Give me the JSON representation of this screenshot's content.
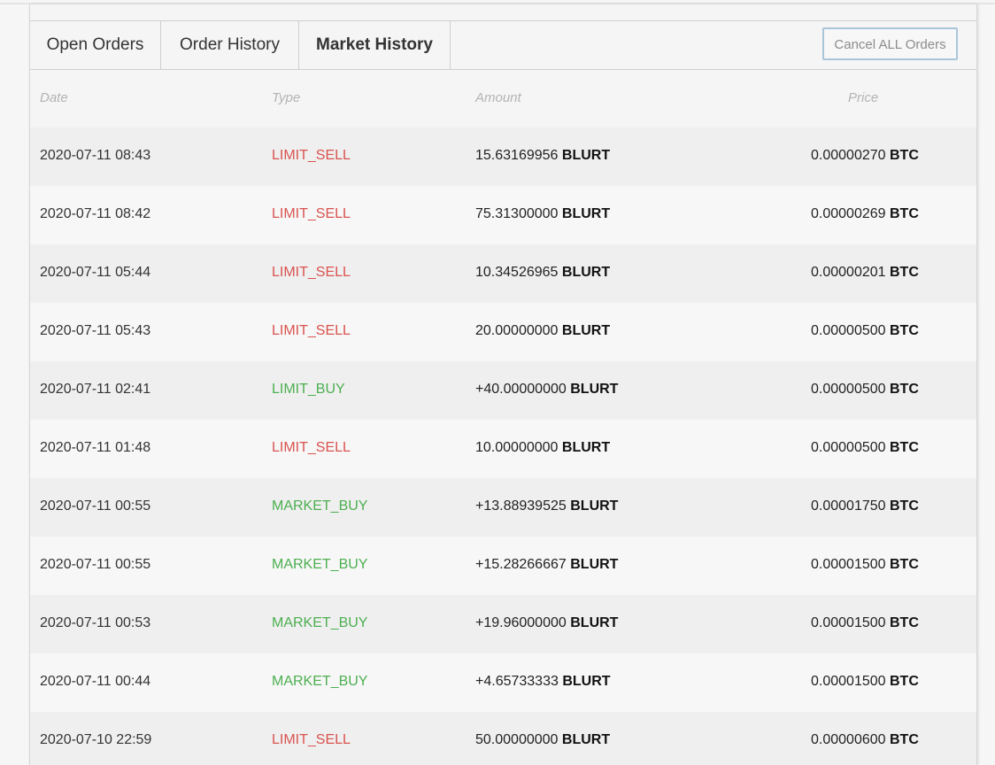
{
  "tabs": {
    "open_orders": "Open Orders",
    "order_history": "Order History",
    "market_history": "Market History"
  },
  "cancel_button": "Cancel ALL Orders",
  "columns": {
    "date": "Date",
    "type": "Type",
    "amount": "Amount",
    "price": "Price"
  },
  "rows": [
    {
      "date": "2020-07-11 08:43",
      "type": "LIMIT_SELL",
      "amount": "15.63169956",
      "amount_unit": "BLURT",
      "price": "0.00000270",
      "price_unit": "BTC"
    },
    {
      "date": "2020-07-11 08:42",
      "type": "LIMIT_SELL",
      "amount": "75.31300000",
      "amount_unit": "BLURT",
      "price": "0.00000269",
      "price_unit": "BTC"
    },
    {
      "date": "2020-07-11 05:44",
      "type": "LIMIT_SELL",
      "amount": "10.34526965",
      "amount_unit": "BLURT",
      "price": "0.00000201",
      "price_unit": "BTC"
    },
    {
      "date": "2020-07-11 05:43",
      "type": "LIMIT_SELL",
      "amount": "20.00000000",
      "amount_unit": "BLURT",
      "price": "0.00000500",
      "price_unit": "BTC"
    },
    {
      "date": "2020-07-11 02:41",
      "type": "LIMIT_BUY",
      "amount": "+40.00000000",
      "amount_unit": "BLURT",
      "price": "0.00000500",
      "price_unit": "BTC"
    },
    {
      "date": "2020-07-11 01:48",
      "type": "LIMIT_SELL",
      "amount": "10.00000000",
      "amount_unit": "BLURT",
      "price": "0.00000500",
      "price_unit": "BTC"
    },
    {
      "date": "2020-07-11 00:55",
      "type": "MARKET_BUY",
      "amount": "+13.88939525",
      "amount_unit": "BLURT",
      "price": "0.00001750",
      "price_unit": "BTC"
    },
    {
      "date": "2020-07-11 00:55",
      "type": "MARKET_BUY",
      "amount": "+15.28266667",
      "amount_unit": "BLURT",
      "price": "0.00001500",
      "price_unit": "BTC"
    },
    {
      "date": "2020-07-11 00:53",
      "type": "MARKET_BUY",
      "amount": "+19.96000000",
      "amount_unit": "BLURT",
      "price": "0.00001500",
      "price_unit": "BTC"
    },
    {
      "date": "2020-07-11 00:44",
      "type": "MARKET_BUY",
      "amount": "+4.65733333",
      "amount_unit": "BLURT",
      "price": "0.00001500",
      "price_unit": "BTC"
    },
    {
      "date": "2020-07-10 22:59",
      "type": "LIMIT_SELL",
      "amount": "50.00000000",
      "amount_unit": "BLURT",
      "price": "0.00000600",
      "price_unit": "BTC"
    }
  ],
  "colors": {
    "sell": "#d9534f",
    "buy": "#4caf50"
  }
}
